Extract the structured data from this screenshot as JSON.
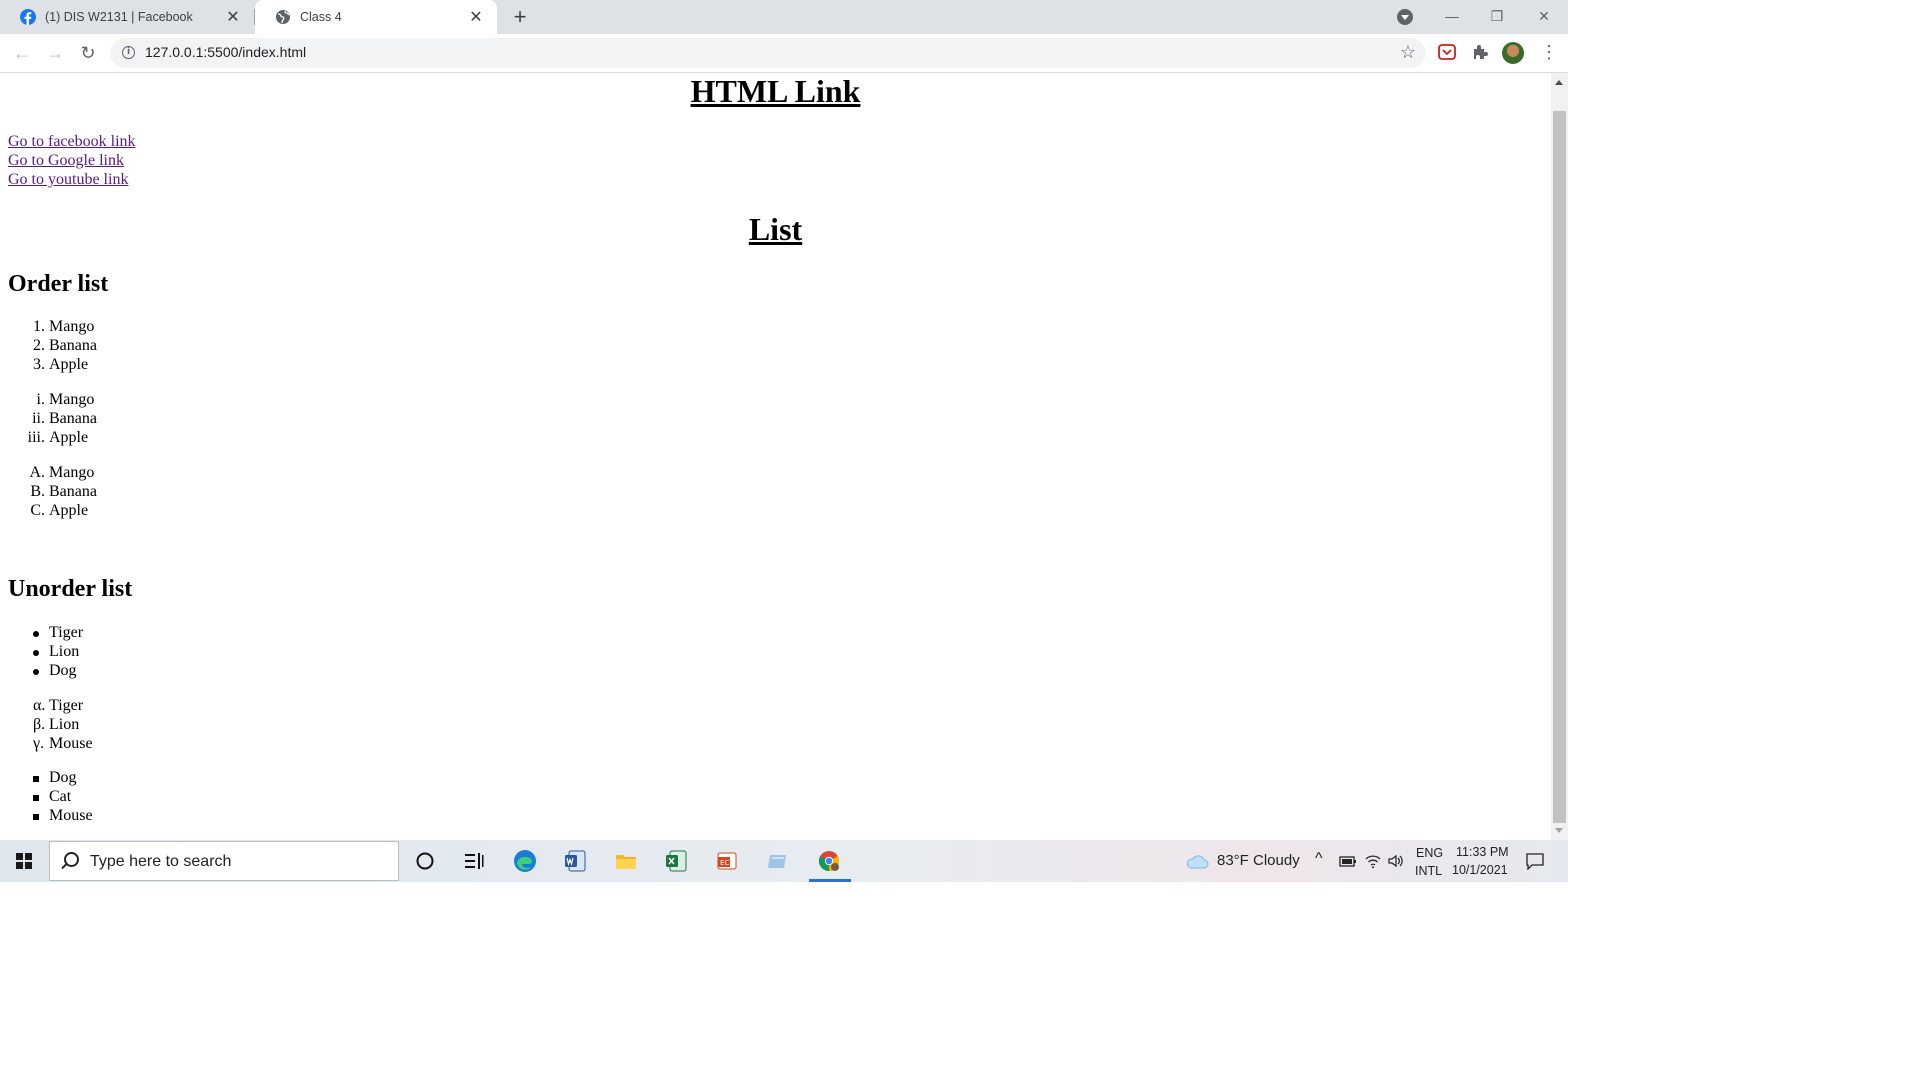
{
  "browser": {
    "tabs": [
      {
        "title": "(1) DIS W2131 | Facebook",
        "active": false,
        "icon": "facebook-icon"
      },
      {
        "title": "Class 4",
        "active": true,
        "icon": "globe-icon"
      }
    ],
    "url": "127.0.0.1:5500/index.html"
  },
  "page": {
    "title": "HTML Link",
    "links": [
      "Go to facebook link",
      "Go to Google link",
      "Go to youtube link"
    ],
    "list_title": "List",
    "order_heading": "Order list",
    "ordered_decimal": {
      "markers": [
        "1.",
        "2.",
        "3."
      ],
      "items": [
        "Mango",
        "Banana",
        "Apple"
      ]
    },
    "ordered_roman": {
      "markers": [
        "i.",
        "ii.",
        "iii."
      ],
      "items": [
        "Mango",
        "Banana",
        "Apple"
      ]
    },
    "ordered_alpha": {
      "markers": [
        "A.",
        "B.",
        "C."
      ],
      "items": [
        "Mango",
        "Banana",
        "Apple"
      ]
    },
    "unorder_heading": "Unorder list",
    "unordered_disc": [
      "Tiger",
      "Lion",
      "Dog"
    ],
    "unordered_greek": {
      "markers": [
        "α.",
        "β.",
        "γ."
      ],
      "items": [
        "Tiger",
        "Lion",
        "Mouse"
      ]
    },
    "unordered_square": [
      "Dog",
      "Cat",
      "Mouse"
    ]
  },
  "taskbar": {
    "search_placeholder": "Type here to search",
    "weather": "83°F  Cloudy",
    "lang_top": "ENG",
    "lang_bottom": "INTL",
    "time": "11:33 PM",
    "date": "10/1/2021"
  }
}
